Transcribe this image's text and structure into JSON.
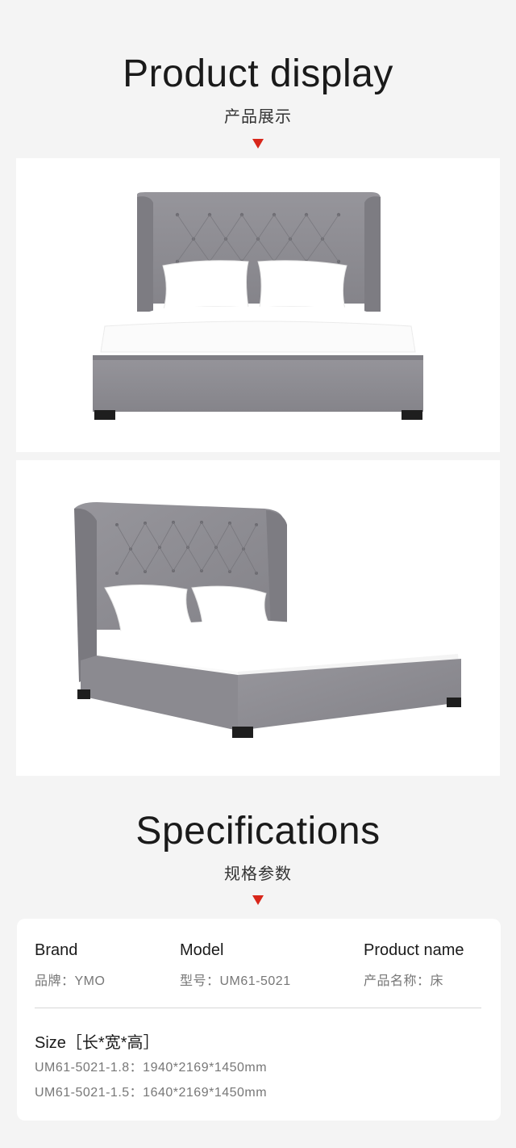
{
  "product_display": {
    "title": "Product display",
    "subtitle": "产品展示"
  },
  "photos": [
    {
      "name": "bed-front-view",
      "icon": "bed-photo"
    },
    {
      "name": "bed-angle-view",
      "icon": "bed-photo"
    }
  ],
  "specifications": {
    "title": "Specifications",
    "subtitle": "规格参数",
    "brand": {
      "label": "Brand",
      "value": "品牌：YMO"
    },
    "model": {
      "label": "Model",
      "value": "型号：UM61-5021"
    },
    "product_name": {
      "label": "Product name",
      "value": "产品名称：床"
    },
    "size": {
      "label": "Size［长*宽*高］",
      "rows": [
        "UM61-5021-1.8：1940*2169*1450mm",
        "UM61-5021-1.5：1640*2169*1450mm"
      ]
    }
  },
  "colors": {
    "accent": "#d8261a",
    "background": "#f4f4f4",
    "fabric": "#8f8e94"
  }
}
